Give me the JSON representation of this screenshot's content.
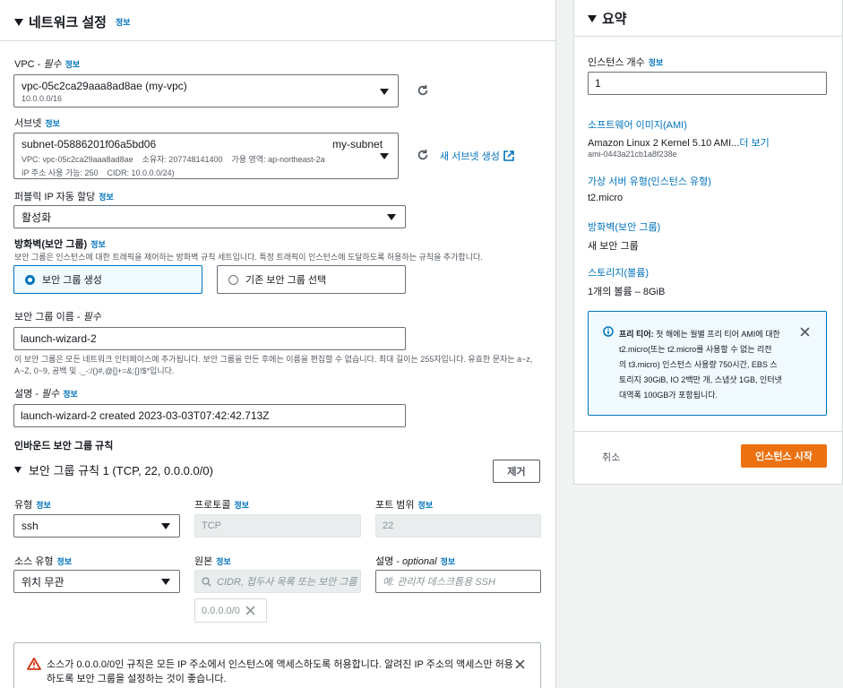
{
  "network": {
    "title": "네트워크 설정",
    "info": "정보",
    "vpc": {
      "label_prefix": "VPC - ",
      "required": "필수",
      "value": "vpc-05c2ca29aaa8ad8ae (my-vpc)",
      "cidr": "10.0.0.0/16"
    },
    "subnet": {
      "label": "서브넷",
      "id": "subnet-05886201f06a5bd06",
      "name": "my-subnet",
      "detail1": "VPC: vpc-05c2ca29aaa8ad8ae    소유자: 207748141400    가용 영역: ap-northeast-2a",
      "detail2": "IP 주소 사용 가능: 250    CIDR: 10.0.0.0/24)",
      "create_link": "새 서브넷 생성"
    },
    "public_ip": {
      "label": "퍼블릭 IP 자동 할당",
      "value": "활성화"
    },
    "firewall": {
      "label": "방화벽(보안 그룹)",
      "description": "보안 그룹은 인스턴스에 대한 트래픽을 제어하는 방화벽 규칙 세트입니다. 특정 트래픽이 인스턴스에 도달하도록 허용하는 규칙을 추가합니다.",
      "option_create": "보안 그룹 생성",
      "option_existing": "기존 보안 그룹 선택"
    },
    "sg_name": {
      "label_prefix": "보안 그룹 이름 - ",
      "required": "필수",
      "value": "launch-wizard-2",
      "hint1": "이 보안 그룹은 모든 네트워크 인터페이스에 추가됩니다. 보안 그룹을 만든 후에는 이름을 편집할 수 없습니다. 최대 길이는 255자입니다. 유효한 문자는 a~z,",
      "hint2": "A~Z, 0~9, 공백 및 ._-:/()#,@[]+=&;{}!$*입니다."
    },
    "description": {
      "label_prefix": "설명 - ",
      "required": "필수",
      "value": "launch-wizard-2 created 2023-03-03T07:42:42.713Z"
    },
    "inbound": {
      "title": "인바운드 보안 그룹 규칙",
      "rule_title": "보안 그룹 규칙 1 (TCP, 22, 0.0.0.0/0)",
      "remove_button": "제거",
      "type_label": "유형",
      "type_value": "ssh",
      "protocol_label": "프로토콜",
      "protocol_value": "TCP",
      "port_label": "포트 범위",
      "port_value": "22",
      "source_type_label": "소스 유형",
      "source_type_value": "위치 무관",
      "source_label": "원본",
      "source_placeholder": "CIDR, 접두사 목록 또는 보안 그룹",
      "source_token": "0.0.0.0/0",
      "desc_label": "설명 - ",
      "desc_optional": "optional",
      "desc_placeholder": "예: 관리자 데스크톱용 SSH"
    },
    "warning": {
      "line1": "소스가 0.0.0.0/0인 규칙은 모든 IP 주소에서 인스턴스에 액세스하도록 허용합니다. 알려진 IP 주소의 액세스만 허용",
      "line2": "하도록 보안 그룹을 설정하는 것이 좋습니다."
    }
  },
  "summary": {
    "title": "요약",
    "count_label": "인스턴스 개수",
    "info": "정보",
    "count_value": "1",
    "ami_label": "소프트웨어 이미지(AMI)",
    "ami_name": "Amazon Linux 2 Kernel 5.10 AMI...",
    "ami_more": "더 보기",
    "ami_id": "ami-0443a21cb1a8f238e",
    "instance_type_label": "가상 서버 유형(인스턴스 유형)",
    "instance_type_value": "t2.micro",
    "firewall_label": "방화벽(보안 그룹)",
    "firewall_value": "새 보안 그룹",
    "storage_label": "스토리지(볼륨)",
    "storage_value": "1개의 볼륨 – 8GiB",
    "free_tier": {
      "bold": "프리 티어:",
      "line1": " 첫 해에는 월별 프리 티어 AMI에 대한",
      "line2": "t2.micro(또는 t2.micro를 사용할 수 없는 리전",
      "line3": "의 t3.micro) 인스턴스 사용량 750시간, EBS 스",
      "line4": "토리지 30GiB, IO 2백만 개, 스냅샷 1GB, 인터넷",
      "line5": "대역폭 100GB가 포함됩니다."
    },
    "cancel": "취소",
    "launch": "인스턴스 시작"
  },
  "colors": {
    "accent": "#0073bb",
    "primary_button": "#ec7211",
    "warning_icon": "#d13212"
  }
}
